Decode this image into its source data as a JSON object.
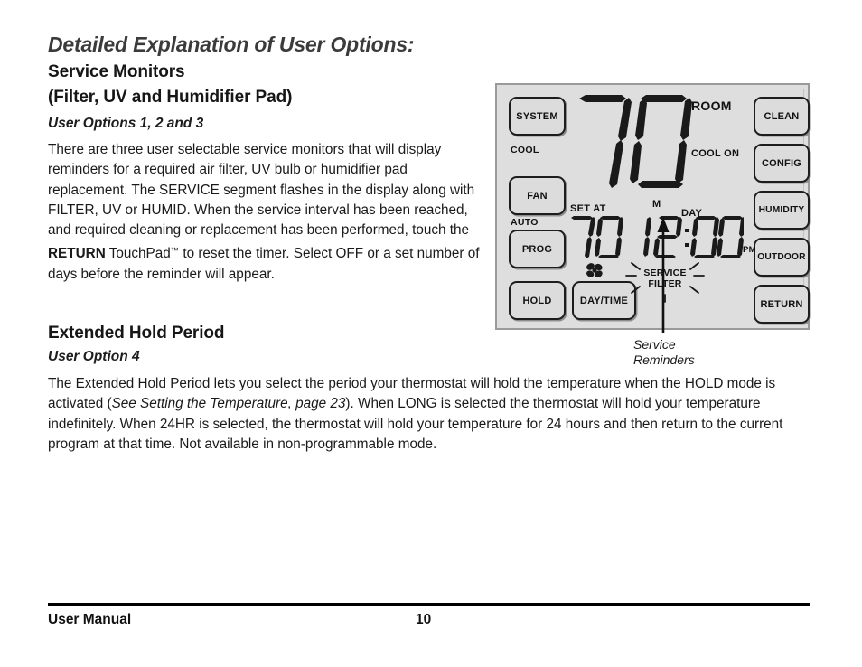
{
  "document": {
    "title": "Detailed Explanation of User Options:",
    "section1": {
      "heading_line1": "Service Monitors",
      "heading_line2": "(Filter, UV and Humidifier Pad)",
      "subheading": "User Options 1, 2 and 3",
      "body_part1": "There are three user selectable service monitors that will display reminders for a required air filter, UV bulb or humidifier pad replacement. The SERVICE segment flashes in the display along with FILTER, UV or HUMID. When the service interval has been reached, and required cleaning or replacement has been performed, touch the ",
      "body_bold": "RETURN",
      "body_part2": " TouchPad",
      "body_tm": "™",
      "body_part3": " to reset the timer. Select OFF or a set number of days before the reminder will appear."
    },
    "section2": {
      "heading": "Extended Hold Period",
      "subheading": "User Option 4",
      "body_part1": "The Extended Hold Period lets you select the period your thermostat will hold the temperature when the HOLD mode is activated (",
      "body_italic": "See Setting the Temperature, page 23",
      "body_part2": "). When LONG is selected the thermostat will hold your temperature indefinitely. When 24HR is selected, the thermostat will hold your temperature for 24 hours and then return to the current program at that time. Not available in non-programmable mode."
    },
    "footer": {
      "left": "User Manual",
      "page_number": "10"
    }
  },
  "figure": {
    "caption_line1": "Service",
    "caption_line2": "Reminders",
    "thermostat": {
      "left_buttons": [
        {
          "label": "SYSTEM",
          "name": "system"
        },
        {
          "label": "FAN",
          "name": "fan"
        },
        {
          "label": "PROG",
          "name": "prog"
        },
        {
          "label": "HOLD",
          "name": "hold"
        }
      ],
      "daytime_button": "DAY/TIME",
      "right_buttons": [
        {
          "label": "CLEAN",
          "name": "clean"
        },
        {
          "label": "CONFIG",
          "name": "config"
        },
        {
          "label": "HUMIDITY",
          "name": "humidity"
        },
        {
          "label": "OUTDOOR",
          "name": "outdoor"
        },
        {
          "label": "RETURN",
          "name": "return"
        }
      ],
      "mode_indicator": "COOL",
      "fan_indicator": "AUTO",
      "room_temperature": "70",
      "room_label": "ROOM",
      "status_label": "COOL ON",
      "set_at_label": "SET AT",
      "set_point": "70",
      "am_pm_minute_indicator": "M",
      "day_label": "DAY",
      "clock_time": "12:00",
      "clock_meridiem": "PM",
      "service_line1": "SERVICE",
      "service_line2": "FILTER"
    },
    "colors": {
      "panel_bg": "#dedede",
      "panel_border": "#9a9a9a",
      "button_border": "#1d1d1d",
      "lcd_segment": "#1a1a1a",
      "title_color": "#3b3b3b"
    }
  }
}
